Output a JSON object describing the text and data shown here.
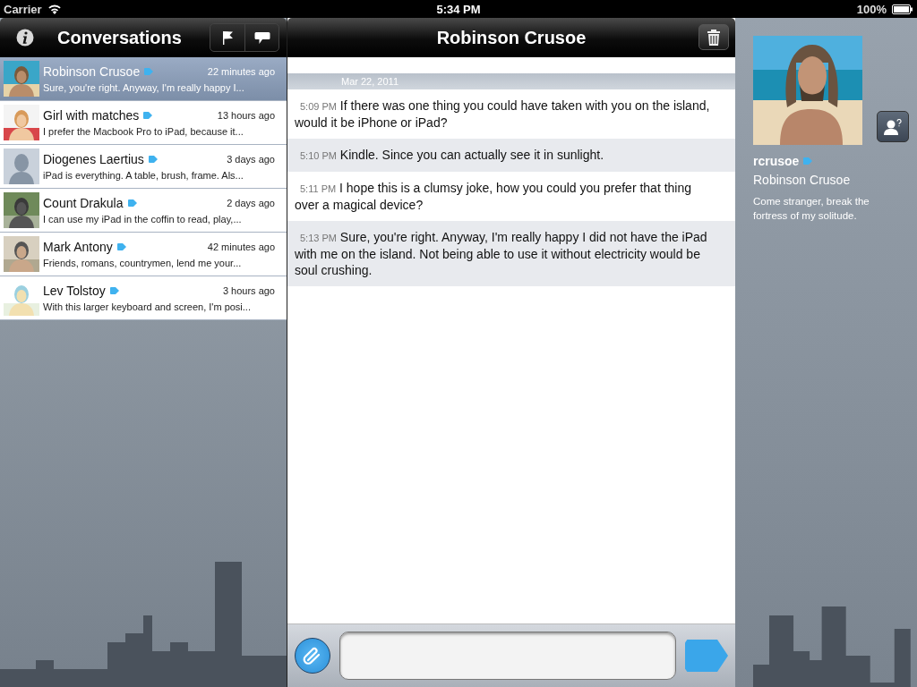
{
  "status_bar": {
    "carrier": "Carrier",
    "time": "5:34 PM",
    "battery": "100%"
  },
  "conversations": {
    "title": "Conversations",
    "items": [
      {
        "name": "Robinson Crusoe",
        "time": "22 minutes ago",
        "preview": "Sure, you're right. Anyway, I'm really happy I...",
        "selected": true
      },
      {
        "name": "Girl with matches",
        "time": "13 hours ago",
        "preview": "I prefer the Macbook Pro to iPad, because it...",
        "selected": false
      },
      {
        "name": "Diogenes Laertius",
        "time": "3 days ago",
        "preview": "iPad is everything. A table, brush, frame. Als...",
        "selected": false
      },
      {
        "name": "Count Drakula",
        "time": "2 days ago",
        "preview": "I can use my iPad in the coffin to read, play,...",
        "selected": false
      },
      {
        "name": "Mark Antony",
        "time": "42 minutes ago",
        "preview": "Friends, romans, countrymen, lend me your...",
        "selected": false
      },
      {
        "name": "Lev Tolstoy",
        "time": "3 hours ago",
        "preview": "With this larger keyboard and screen, I'm posi...",
        "selected": false
      }
    ]
  },
  "chat": {
    "title": "Robinson Crusoe",
    "date": "Mar 22, 2011",
    "messages": [
      {
        "time": "5:09 PM",
        "text": "If there was one thing you could have taken with you on the island, would it be iPhone or iPad?"
      },
      {
        "time": "5:10 PM",
        "text": "Kindle. Since you can actually see it in sunlight."
      },
      {
        "time": "5:11 PM",
        "text": "I hope this is a clumsy joke, how you could you prefer that thing over a magical device?"
      },
      {
        "time": "5:13 PM",
        "text": "Sure, you're right. Anyway, I'm really happy I did not have the iPad with me on the island. Not being able to use it without electricity would be soul crushing."
      }
    ]
  },
  "profile": {
    "username": "rcrusoe",
    "full_name": "Robinson Crusoe",
    "status": "Come stranger, break the fortress of my solitude."
  }
}
